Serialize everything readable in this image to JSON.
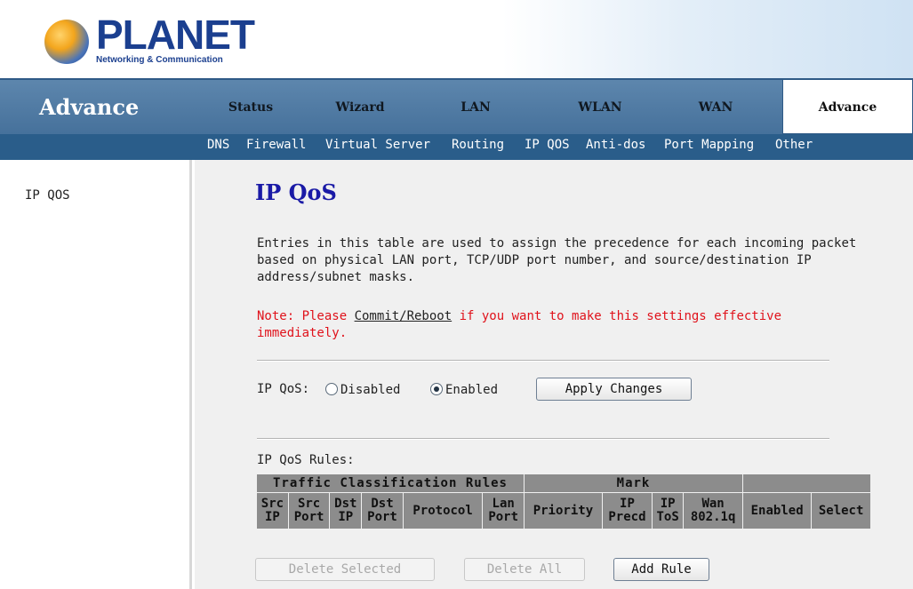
{
  "logo": {
    "brand": "PLANET",
    "tagline": "Networking & Communication"
  },
  "nav": {
    "section_title": "Advance",
    "tabs": [
      {
        "label": "Status"
      },
      {
        "label": "Wizard"
      },
      {
        "label": "LAN"
      },
      {
        "label": "WLAN"
      },
      {
        "label": "WAN"
      },
      {
        "label": "Advance",
        "active": true
      }
    ]
  },
  "subnav": {
    "links": [
      "DNS",
      "Firewall",
      "Virtual Server",
      "Routing",
      "IP QOS",
      "Anti-dos",
      "Port Mapping",
      "Other"
    ]
  },
  "sidebar": {
    "items": [
      "IP QOS"
    ]
  },
  "page": {
    "title": "IP QoS",
    "description": "Entries in this table are used to assign the precedence for each incoming packet based on physical LAN port, TCP/UDP port number, and source/destination IP address/subnet masks.",
    "note_prefix": "Note: Please ",
    "note_link": "Commit/Reboot",
    "note_suffix": " if you want to make this settings effective immediately."
  },
  "qos": {
    "label": "IP QoS:",
    "options": [
      "Disabled",
      "Enabled"
    ],
    "selected": "Enabled",
    "apply_button": "Apply Changes"
  },
  "rules": {
    "label": "IP QoS Rules:",
    "group_headers": [
      "Traffic Classification Rules",
      "Mark",
      ""
    ],
    "columns": [
      {
        "line1": "Src",
        "line2": "IP"
      },
      {
        "line1": "Src",
        "line2": "Port"
      },
      {
        "line1": "Dst",
        "line2": "IP"
      },
      {
        "line1": "Dst",
        "line2": "Port"
      },
      {
        "line1": "Protocol",
        "line2": ""
      },
      {
        "line1": "Lan",
        "line2": "Port"
      },
      {
        "line1": "Priority",
        "line2": ""
      },
      {
        "line1": "IP",
        "line2": "Precd"
      },
      {
        "line1": "IP",
        "line2": "ToS"
      },
      {
        "line1": "Wan",
        "line2": "802.1q"
      },
      {
        "line1": "Enabled",
        "line2": ""
      },
      {
        "line1": "Select",
        "line2": ""
      }
    ],
    "rows": []
  },
  "buttons": {
    "delete_selected": "Delete Selected",
    "delete_all": "Delete All",
    "add_rule": "Add Rule"
  },
  "colors": {
    "nav_bar": "#46719b",
    "sub_nav": "#2a5d8a",
    "title_blue": "#1a1aa6",
    "note_red": "#e0121b",
    "table_header": "#8c8c8c"
  }
}
